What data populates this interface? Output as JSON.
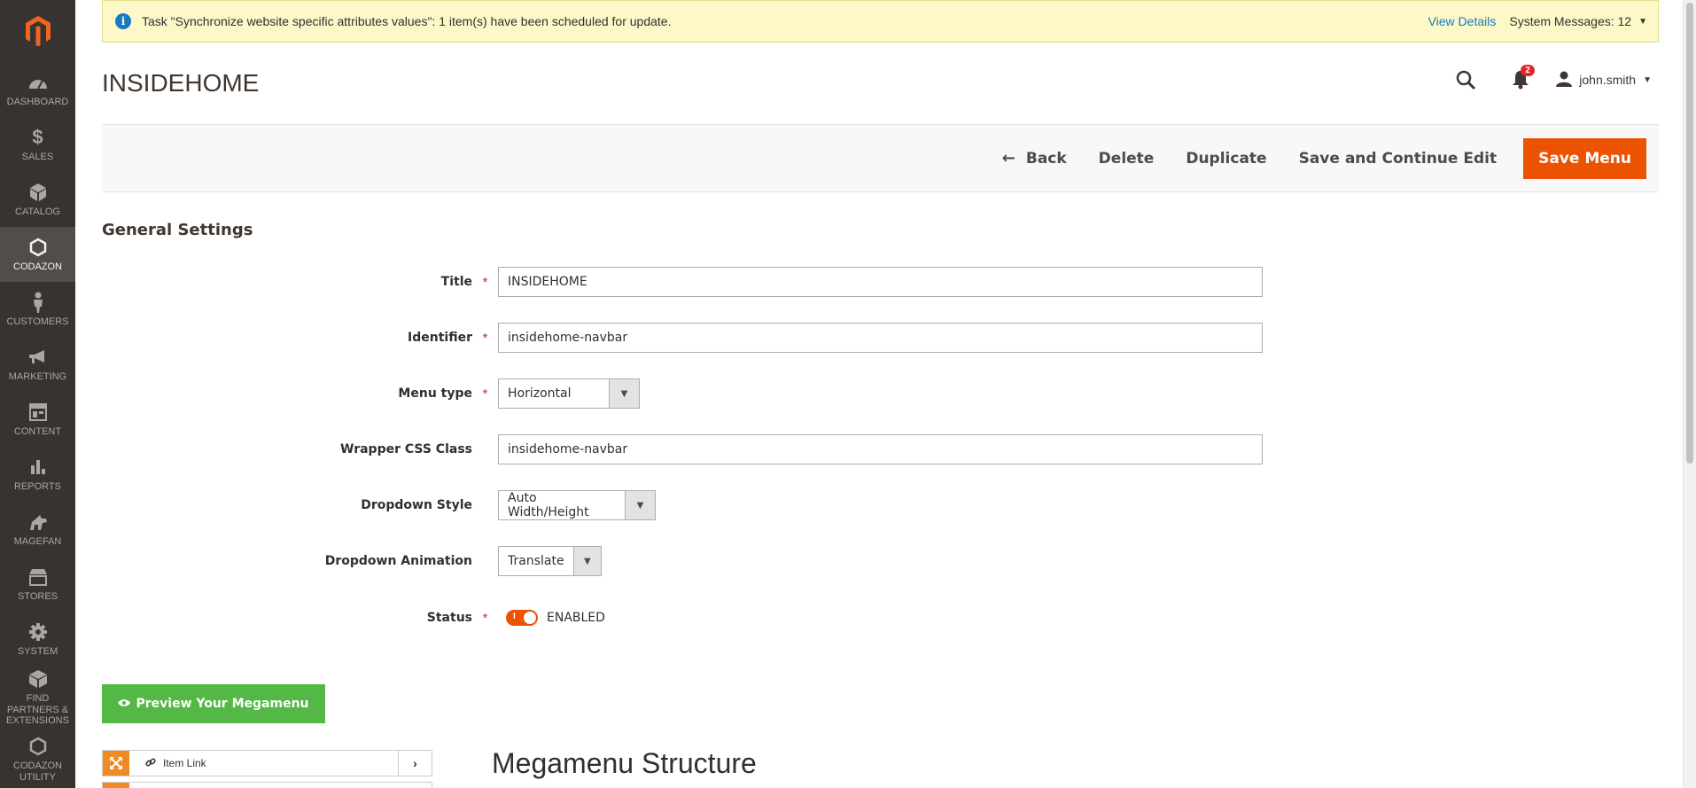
{
  "sidebar": {
    "items": [
      {
        "label": "DASHBOARD",
        "icon": "dashboard-icon"
      },
      {
        "label": "SALES",
        "icon": "dollar-icon"
      },
      {
        "label": "CATALOG",
        "icon": "cube-icon"
      },
      {
        "label": "CODAZON",
        "icon": "hexagon-icon",
        "active": true
      },
      {
        "label": "CUSTOMERS",
        "icon": "person-icon"
      },
      {
        "label": "MARKETING",
        "icon": "megaphone-icon"
      },
      {
        "label": "CONTENT",
        "icon": "layout-icon"
      },
      {
        "label": "REPORTS",
        "icon": "bar-chart-icon"
      },
      {
        "label": "MAGEFAN",
        "icon": "magefan-icon"
      },
      {
        "label": "STORES",
        "icon": "storefront-icon"
      },
      {
        "label": "SYSTEM",
        "icon": "gear-icon"
      },
      {
        "label": "FIND PARTNERS & EXTENSIONS",
        "icon": "box-icon"
      },
      {
        "label": "CODAZON UTILITY",
        "icon": "hexagon-icon"
      }
    ]
  },
  "message": {
    "text": "Task \"Synchronize website specific attributes values\": 1 item(s) have been scheduled for update.",
    "view_details": "View Details",
    "system_messages": "System Messages: 12"
  },
  "header": {
    "title": "INSIDEHOME",
    "notification_count": "2",
    "username": "john.smith"
  },
  "actions": {
    "back": "Back",
    "delete": "Delete",
    "duplicate": "Duplicate",
    "save_continue": "Save and Continue Edit",
    "save_menu": "Save Menu"
  },
  "form": {
    "section_title": "General Settings",
    "title_label": "Title",
    "title_value": "INSIDEHOME",
    "identifier_label": "Identifier",
    "identifier_value": "insidehome-navbar",
    "menu_type_label": "Menu type",
    "menu_type_value": "Horizontal",
    "wrapper_label": "Wrapper CSS Class",
    "wrapper_value": "insidehome-navbar",
    "dropdown_style_label": "Dropdown Style",
    "dropdown_style_value": "Auto Width/Height",
    "dropdown_anim_label": "Dropdown Animation",
    "dropdown_anim_value": "Translate",
    "status_label": "Status",
    "status_value": "ENABLED"
  },
  "preview": {
    "label": "Preview Your Megamenu"
  },
  "structure": {
    "item_link_label": "Item Link",
    "title": "Megamenu Structure"
  }
}
